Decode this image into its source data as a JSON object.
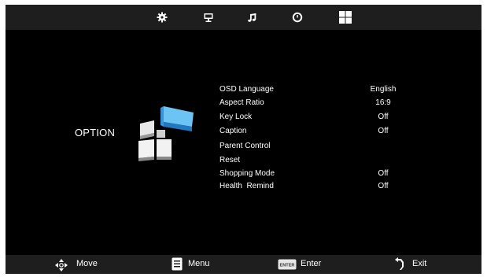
{
  "top_tabs": [
    {
      "name": "picture",
      "icon": "gear-icon"
    },
    {
      "name": "screen",
      "icon": "monitor-icon"
    },
    {
      "name": "sound",
      "icon": "music-note-icon"
    },
    {
      "name": "time",
      "icon": "clock-icon"
    },
    {
      "name": "option",
      "icon": "grid-icon",
      "selected": true
    }
  ],
  "page_title": "OPTION",
  "menu": {
    "items": [
      {
        "label": "OSD Language",
        "value": "English"
      },
      {
        "label": "Aspect Ratio",
        "value": "16:9"
      },
      {
        "label": "Key Lock",
        "value": "Off"
      },
      {
        "label": "Caption",
        "value": "Off"
      },
      {
        "label": "Parent Control",
        "value": ""
      },
      {
        "label": "Reset",
        "value": ""
      },
      {
        "label": "Shopping Mode",
        "value": "Off"
      },
      {
        "label": "Health  Remind",
        "value": "Off"
      }
    ]
  },
  "footer": {
    "move": {
      "label": "Move",
      "icon": "dpad-arrows-icon"
    },
    "menu": {
      "label": "Menu",
      "icon": "menu-icon"
    },
    "enter": {
      "label": "Enter",
      "icon": "enter-key-icon",
      "key_text": "ENTER"
    },
    "exit": {
      "label": "Exit",
      "icon": "return-arrow-icon"
    }
  },
  "colors": {
    "background": "#000000",
    "bar": "#1e1e1e",
    "accent": "#2f9be0",
    "text": "#ffffff"
  }
}
